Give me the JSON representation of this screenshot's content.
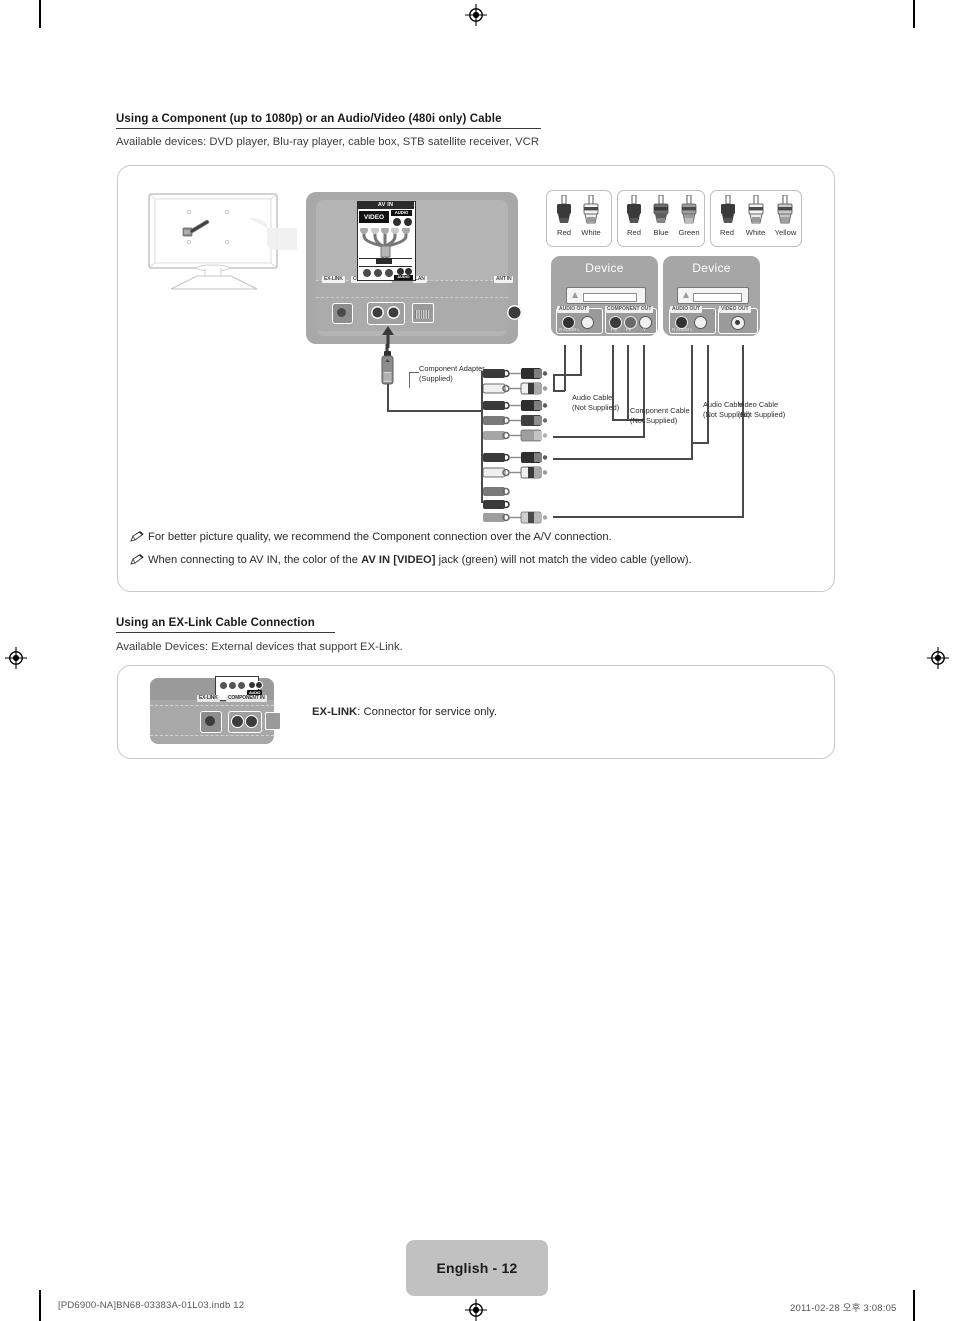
{
  "document": {
    "page_badge": "English - 12",
    "footer_left": "[PD6900-NA]BN68-03383A-01L03.indb   12",
    "footer_right": "2011-02-28   오후 3:08:05"
  },
  "section_component": {
    "heading": "Using a Component (up to 1080p) or an Audio/Video (480i only) Cable",
    "subheading": "Available devices: DVD player, Blu-ray player, cable box, STB satellite receiver, VCR",
    "tv_panel": {
      "av_in_title": "AV IN",
      "av_video_label": "VIDEO",
      "av_audio_label": "AUDIO",
      "av_audio_lr": "L",
      "av_audio_r": "R",
      "port_labels": [
        "EX-LINK",
        "COMPONENT IN",
        "LAN",
        "ANT IN"
      ],
      "component_audio_label": "AUDIO"
    },
    "plug_groups": [
      {
        "name": "audio-plugs",
        "labels": [
          "Red",
          "White"
        ],
        "colors": [
          "#3a3a3a",
          "#f2f2f2"
        ]
      },
      {
        "name": "component-plugs",
        "labels": [
          "Red",
          "Blue",
          "Green"
        ],
        "colors": [
          "#3a3a3a",
          "#6e6e6e",
          "#9d9d9d"
        ]
      },
      {
        "name": "av-plugs",
        "labels": [
          "Red",
          "White",
          "Yellow"
        ],
        "colors": [
          "#3a3a3a",
          "#f2f2f2",
          "#c9c9c9"
        ]
      }
    ],
    "devices": [
      {
        "title": "Device",
        "port_groups": [
          {
            "label": "AUDIO OUT",
            "jack_labels": [
              "R",
              "AUDIO",
              "L"
            ]
          },
          {
            "label": "COMPONENT OUT",
            "jack_labels": [
              "Pʙ",
              "Pʀ",
              "Y"
            ]
          }
        ]
      },
      {
        "title": "Device",
        "port_groups": [
          {
            "label": "AUDIO OUT",
            "jack_labels": [
              "R",
              "AUDIO",
              "L"
            ]
          },
          {
            "label": "VIDEO OUT",
            "jack_labels": []
          }
        ]
      }
    ],
    "cable_labels": [
      {
        "name": "component-adapter",
        "line1": "Component Adapter",
        "line2": "(Supplied)"
      },
      {
        "name": "audio-cable-1",
        "line1": "Audio Cable",
        "line2": "(Not Supplied)"
      },
      {
        "name": "component-cable",
        "line1": "Component Cable",
        "line2": "(Not Supplied)"
      },
      {
        "name": "audio-cable-2",
        "line1": "Audio Cable",
        "line2": "(Not Supplied)"
      },
      {
        "name": "video-cable",
        "line1": "Video Cable",
        "line2": "(Not Supplied)"
      }
    ],
    "notes": [
      {
        "pre": "For better picture quality, we recommend the Component connection over the A/V connection.",
        "bold": "",
        "post": ""
      },
      {
        "pre": "When connecting to AV IN, the color of the ",
        "bold": "AV IN [VIDEO]",
        "post": " jack (green) will not match the video cable (yellow)."
      }
    ]
  },
  "section_exlink": {
    "heading": "Using an EX-Link Cable Connection",
    "subheading": "Available Devices: External devices that support EX-Link.",
    "callout_bold": "EX-LINK",
    "callout_rest": ": Connector for service only.",
    "port_labels": [
      "EX-LINK",
      "COMPONENT IN",
      "AUDIO"
    ]
  }
}
